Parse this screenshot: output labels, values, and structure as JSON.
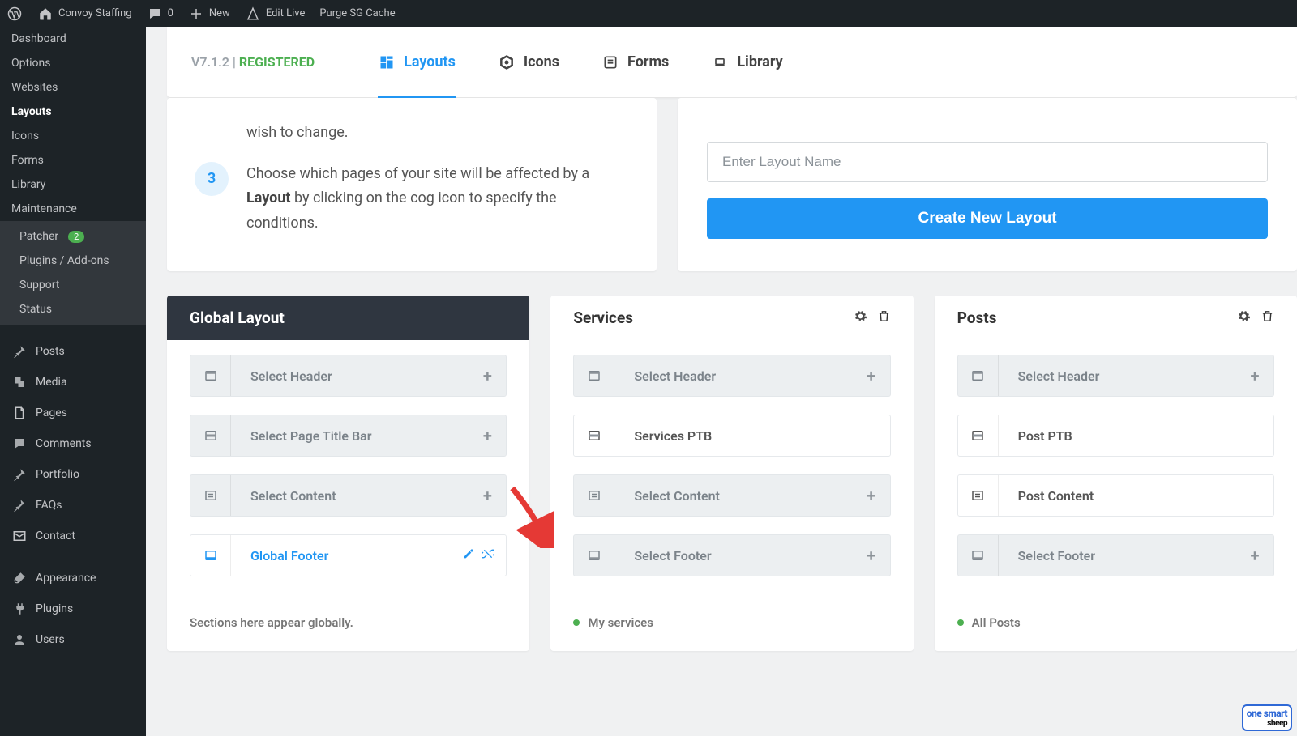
{
  "adminbar": {
    "site_name": "Convoy Staffing",
    "comments": "0",
    "new": "New",
    "edit_live": "Edit Live",
    "purge": "Purge SG Cache"
  },
  "sidebar": {
    "builder_items": [
      "Dashboard",
      "Options",
      "Websites",
      "Layouts",
      "Icons",
      "Forms",
      "Library",
      "Maintenance"
    ],
    "builder_active": "Layouts",
    "sub_items": [
      {
        "label": "Patcher",
        "badge": "2"
      },
      {
        "label": "Plugins / Add-ons"
      },
      {
        "label": "Support"
      },
      {
        "label": "Status"
      }
    ],
    "wp_items": [
      {
        "label": "Posts",
        "icon": "pin"
      },
      {
        "label": "Media",
        "icon": "media"
      },
      {
        "label": "Pages",
        "icon": "pages"
      },
      {
        "label": "Comments",
        "icon": "comment"
      },
      {
        "label": "Portfolio",
        "icon": "pin"
      },
      {
        "label": "FAQs",
        "icon": "pin"
      },
      {
        "label": "Contact",
        "icon": "mail"
      },
      {
        "label": "Appearance",
        "icon": "brush"
      },
      {
        "label": "Plugins",
        "icon": "plug"
      },
      {
        "label": "Users",
        "icon": "user"
      }
    ]
  },
  "tabbar": {
    "version": "V7.1.2",
    "sep": " | ",
    "reg": "REGISTERED",
    "tabs": [
      {
        "label": "Layouts",
        "icon": "dashboard",
        "active": true
      },
      {
        "label": "Icons",
        "icon": "hex"
      },
      {
        "label": "Forms",
        "icon": "form"
      },
      {
        "label": "Library",
        "icon": "library"
      }
    ]
  },
  "intro": {
    "partial": "wish to change.",
    "step3_num": "3",
    "step3_a": "Choose which pages of your site will be affected by a ",
    "step3_b": "Layout",
    "step3_c": " by clicking on the cog icon to specify the conditions."
  },
  "create": {
    "placeholder": "Enter Layout Name",
    "button": "Create New Layout"
  },
  "cards": [
    {
      "title": "Global Layout",
      "dark": true,
      "slots": [
        {
          "label": "Select Header",
          "type": "empty",
          "icon": "header"
        },
        {
          "label": "Select Page Title Bar",
          "type": "empty",
          "icon": "titlebar"
        },
        {
          "label": "Select Content",
          "type": "empty",
          "icon": "content"
        },
        {
          "label": "Global Footer",
          "type": "link",
          "icon": "footer",
          "actions": [
            "edit",
            "unlink"
          ]
        }
      ],
      "footer": "Sections here appear globally."
    },
    {
      "title": "Services",
      "dark": false,
      "gear": true,
      "slots": [
        {
          "label": "Select Header",
          "type": "empty",
          "icon": "header"
        },
        {
          "label": "Services PTB",
          "type": "assigned",
          "icon": "titlebar"
        },
        {
          "label": "Select Content",
          "type": "empty",
          "icon": "content"
        },
        {
          "label": "Select Footer",
          "type": "empty",
          "icon": "footer"
        }
      ],
      "footer": "My services",
      "footer_dot": true
    },
    {
      "title": "Posts",
      "dark": false,
      "gear": true,
      "slots": [
        {
          "label": "Select Header",
          "type": "empty",
          "icon": "header"
        },
        {
          "label": "Post PTB",
          "type": "assigned",
          "icon": "titlebar"
        },
        {
          "label": "Post Content",
          "type": "assigned",
          "icon": "content"
        },
        {
          "label": "Select Footer",
          "type": "empty",
          "icon": "footer"
        }
      ],
      "footer": "All Posts",
      "footer_dot": true
    }
  ],
  "watermark": {
    "line1": "one smart",
    "line2": "sheep"
  }
}
